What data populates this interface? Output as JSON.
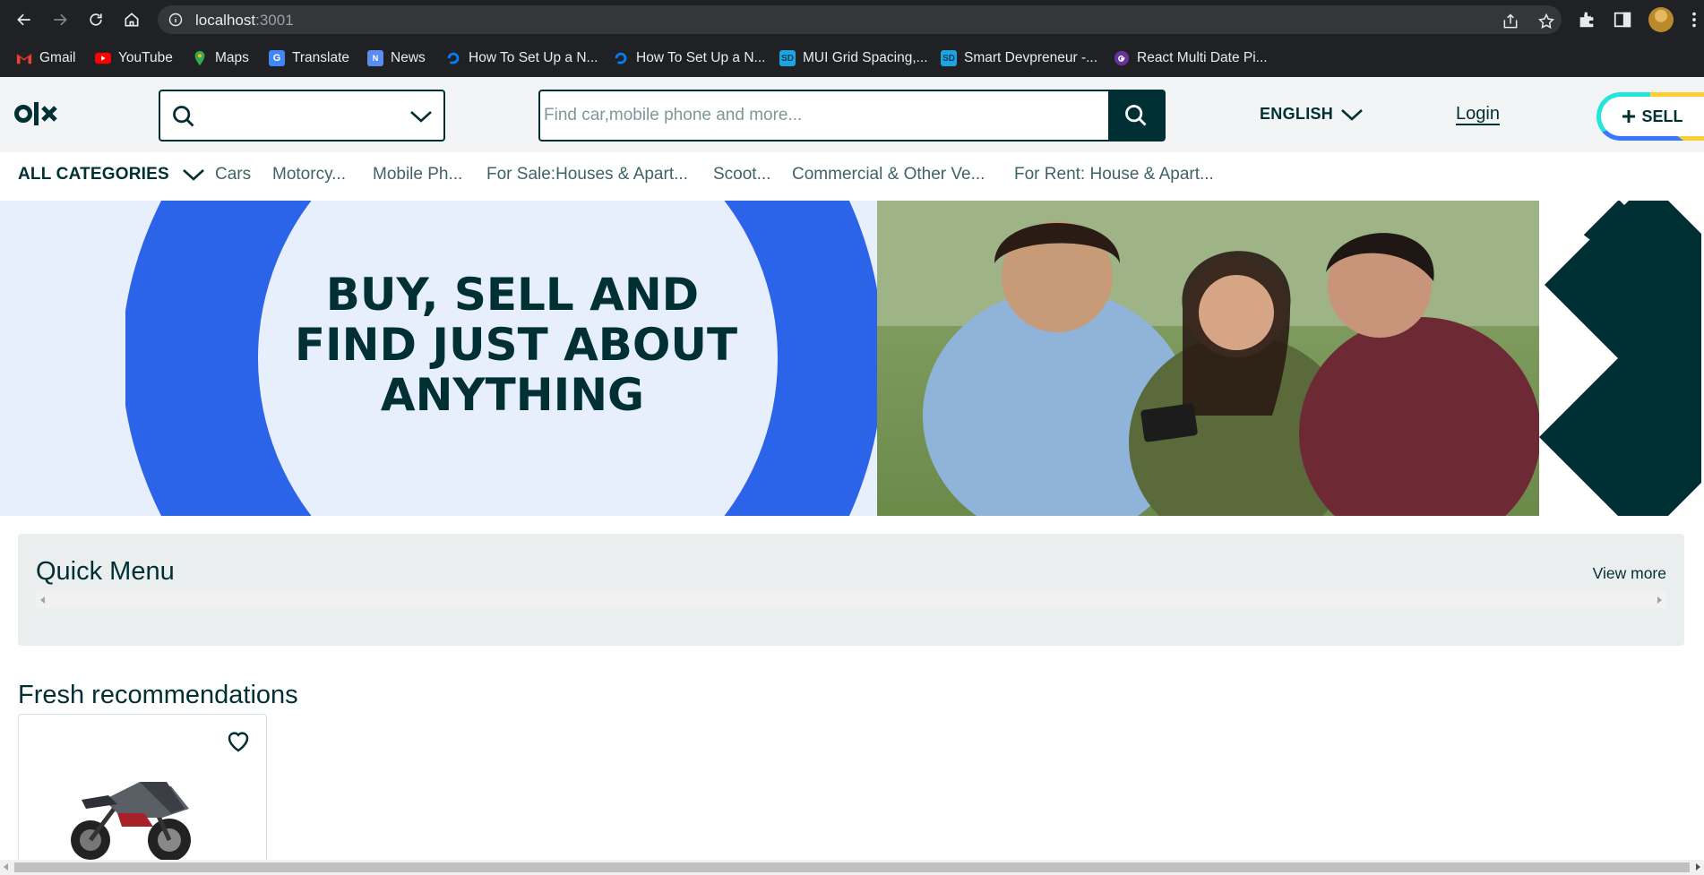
{
  "browser": {
    "url_host": "localhost",
    "url_port": ":3001",
    "bookmarks": [
      {
        "label": "Gmail",
        "icon": "gmail-icon"
      },
      {
        "label": "YouTube",
        "icon": "youtube-icon"
      },
      {
        "label": "Maps",
        "icon": "maps-icon"
      },
      {
        "label": "Translate",
        "icon": "translate-icon"
      },
      {
        "label": "News",
        "icon": "news-icon"
      },
      {
        "label": "How To Set Up a N...",
        "icon": "digitalocean-icon"
      },
      {
        "label": "How To Set Up a N...",
        "icon": "digitalocean-icon"
      },
      {
        "label": "MUI Grid Spacing,...",
        "icon": "sd-icon"
      },
      {
        "label": "Smart Devpreneur -...",
        "icon": "sd-icon"
      },
      {
        "label": "React Multi Date Pi...",
        "icon": "gatsby-icon"
      }
    ]
  },
  "header": {
    "logo_text": "olx",
    "search_placeholder": "Find car,mobile phone and more...",
    "language": "ENGLISH",
    "login": "Login",
    "sell": "SELL"
  },
  "categories": {
    "all_label": "ALL CATEGORIES",
    "items": [
      "Cars",
      "Motorcy...",
      "Mobile Ph...",
      "For Sale:Houses & Apart...",
      "Scoot...",
      "Commercial & Other Ve...",
      "For Rent: House & Apart..."
    ]
  },
  "banner": {
    "line1": "BUY, SELL AND",
    "line2": "FIND JUST ABOUT",
    "line3": "ANYTHING"
  },
  "quick_menu": {
    "title": "Quick Menu",
    "view_more": "View more"
  },
  "fresh": {
    "title": "Fresh recommendations"
  },
  "colors": {
    "brand_dark": "#002f34",
    "banner_blue": "#2b64e8",
    "banner_light": "#e7effc",
    "sell_yellow": "#ffce32",
    "sell_blue": "#3a77ff",
    "sell_teal": "#23e5db"
  }
}
